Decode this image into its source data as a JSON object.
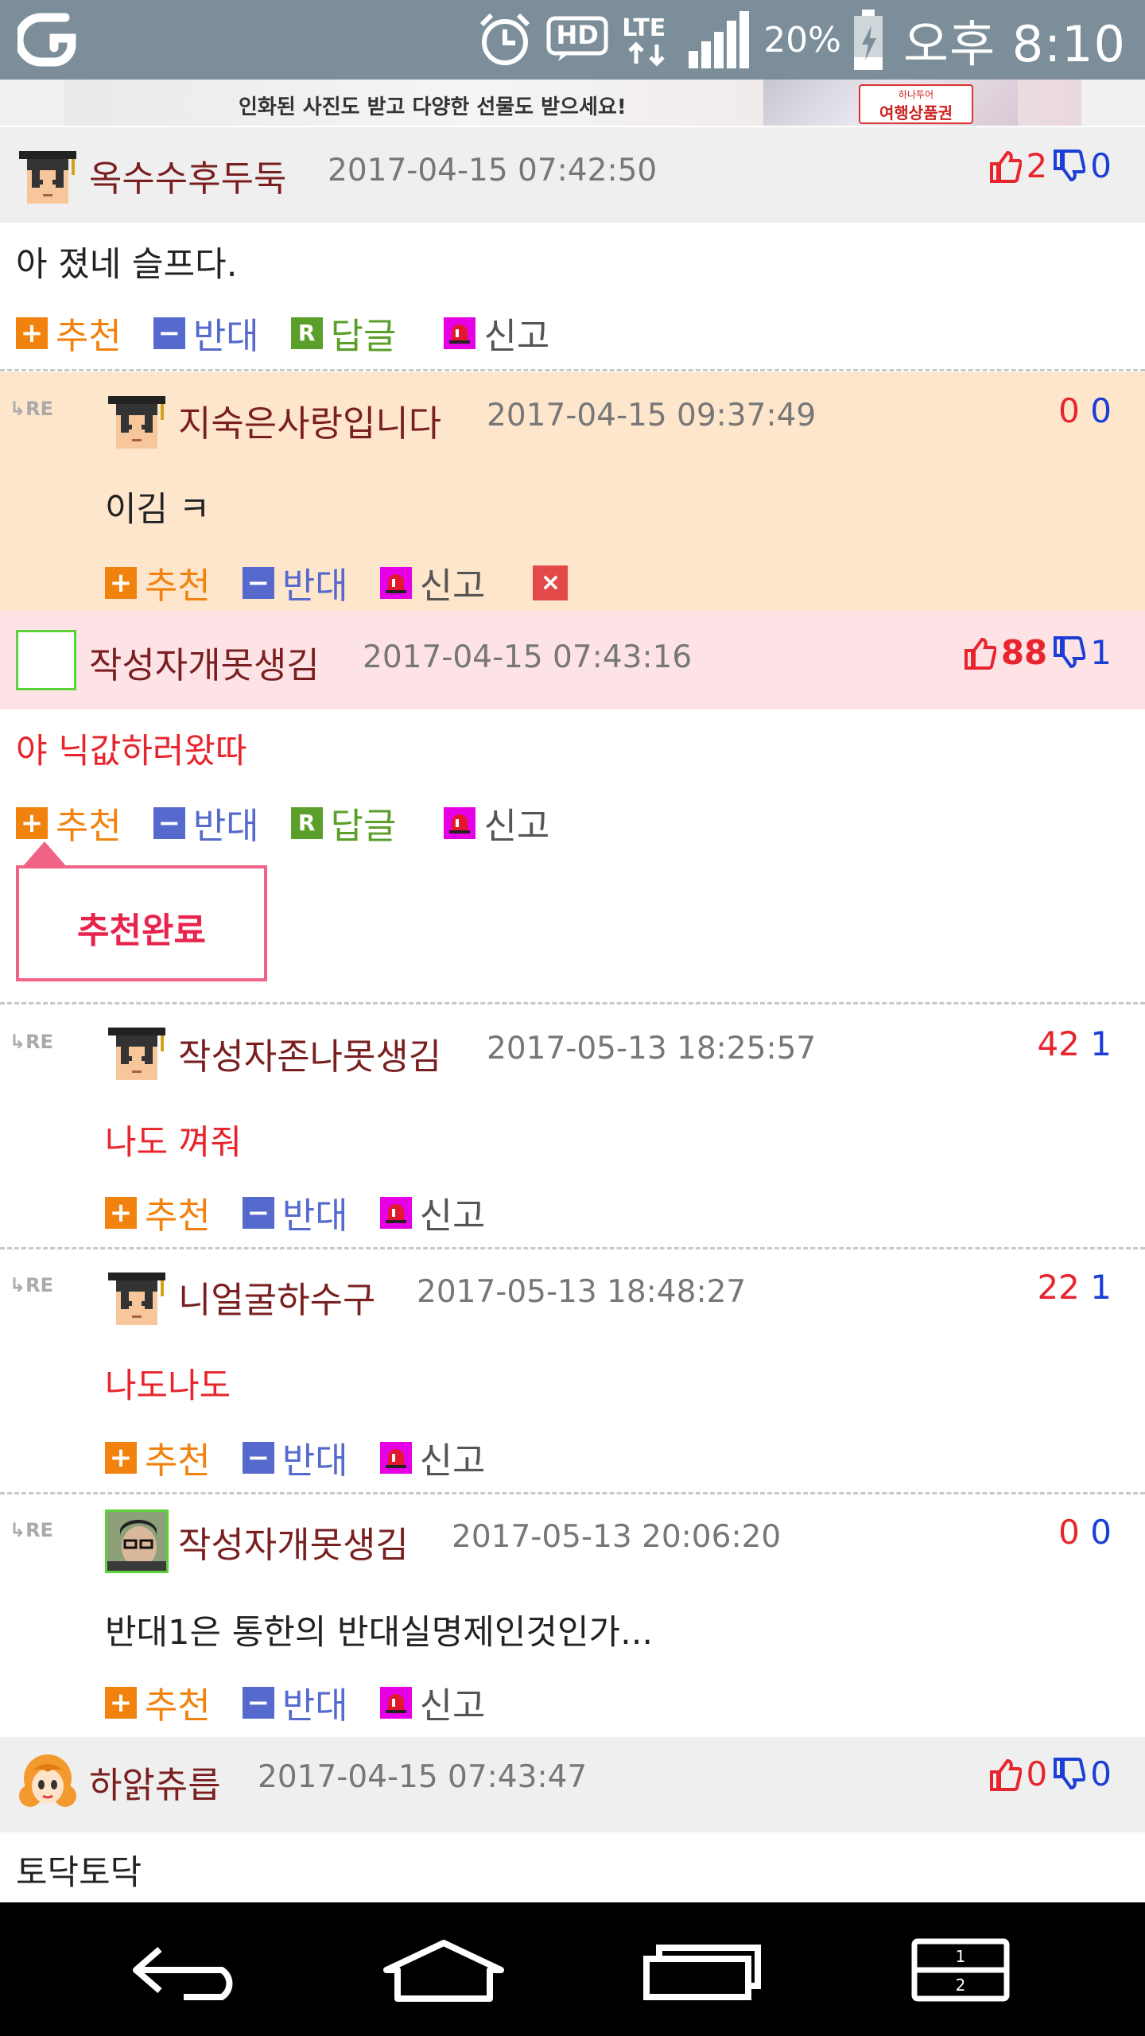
{
  "status_bar": {
    "network_type": "LTE",
    "hd_label": "HD",
    "battery": "20%",
    "time": "오후 8:10"
  },
  "ad": {
    "text": "인화된 사진도 받고 다양한 선물도 받으세요!",
    "voucher_brand": "하나투어",
    "voucher_label": "여행상품권"
  },
  "labels": {
    "recommend": "추천",
    "oppose": "반대",
    "reply": "답글",
    "report": "신고",
    "re": "RE",
    "recommend_done": "추천완료",
    "reply_icon": "R",
    "recommend_icon": "+",
    "oppose_icon": "−",
    "delete_icon": "×"
  },
  "comments": [
    {
      "nick": "옥수수후두둑",
      "date": "2017-04-15 07:42:50",
      "text": "아 졌네 슬프다.",
      "up": "2",
      "down": "0",
      "avatar": "grad-cap-avatar"
    },
    {
      "nick": "지숙은사랑입니다",
      "date": "2017-04-15 09:37:49",
      "text": "이김 ㅋ",
      "up": "0",
      "down": "0",
      "avatar": "grad-cap-avatar"
    },
    {
      "nick": "작성자개못생김",
      "date": "2017-04-15 07:43:16",
      "text": "야 닉값하러왔따",
      "up": "88",
      "down": "1",
      "avatar": "empty-avatar"
    },
    {
      "nick": "작성자존나못생김",
      "date": "2017-05-13 18:25:57",
      "text": "나도 껴줘",
      "up": "42",
      "down": "1",
      "avatar": "grad-cap-avatar"
    },
    {
      "nick": "니얼굴하수구",
      "date": "2017-05-13 18:48:27",
      "text": "나도나도",
      "up": "22",
      "down": "1",
      "avatar": "grad-cap-avatar"
    },
    {
      "nick": "작성자개못생김",
      "date": "2017-05-13 20:06:20",
      "text": "반대1은 통한의 반대실명제인것인가...",
      "up": "0",
      "down": "0",
      "avatar": "photo-avatar"
    },
    {
      "nick": "하앍츄릅",
      "date": "2017-04-15 07:43:47",
      "text": "토닥토닥",
      "up": "0",
      "down": "0",
      "avatar": "cartoon-girl-avatar"
    }
  ],
  "colors": {
    "status_bar": "#7b8e9a",
    "gray_band": "#efefef",
    "pink_band": "#fde3e6",
    "peach_reply": "#fde6cc",
    "recommend": "#f2820e",
    "oppose": "#5669cc",
    "reply": "#5a9f2a",
    "report": "#e600e6",
    "up_count": "#e8242c",
    "down_count": "#1b3ed6"
  }
}
